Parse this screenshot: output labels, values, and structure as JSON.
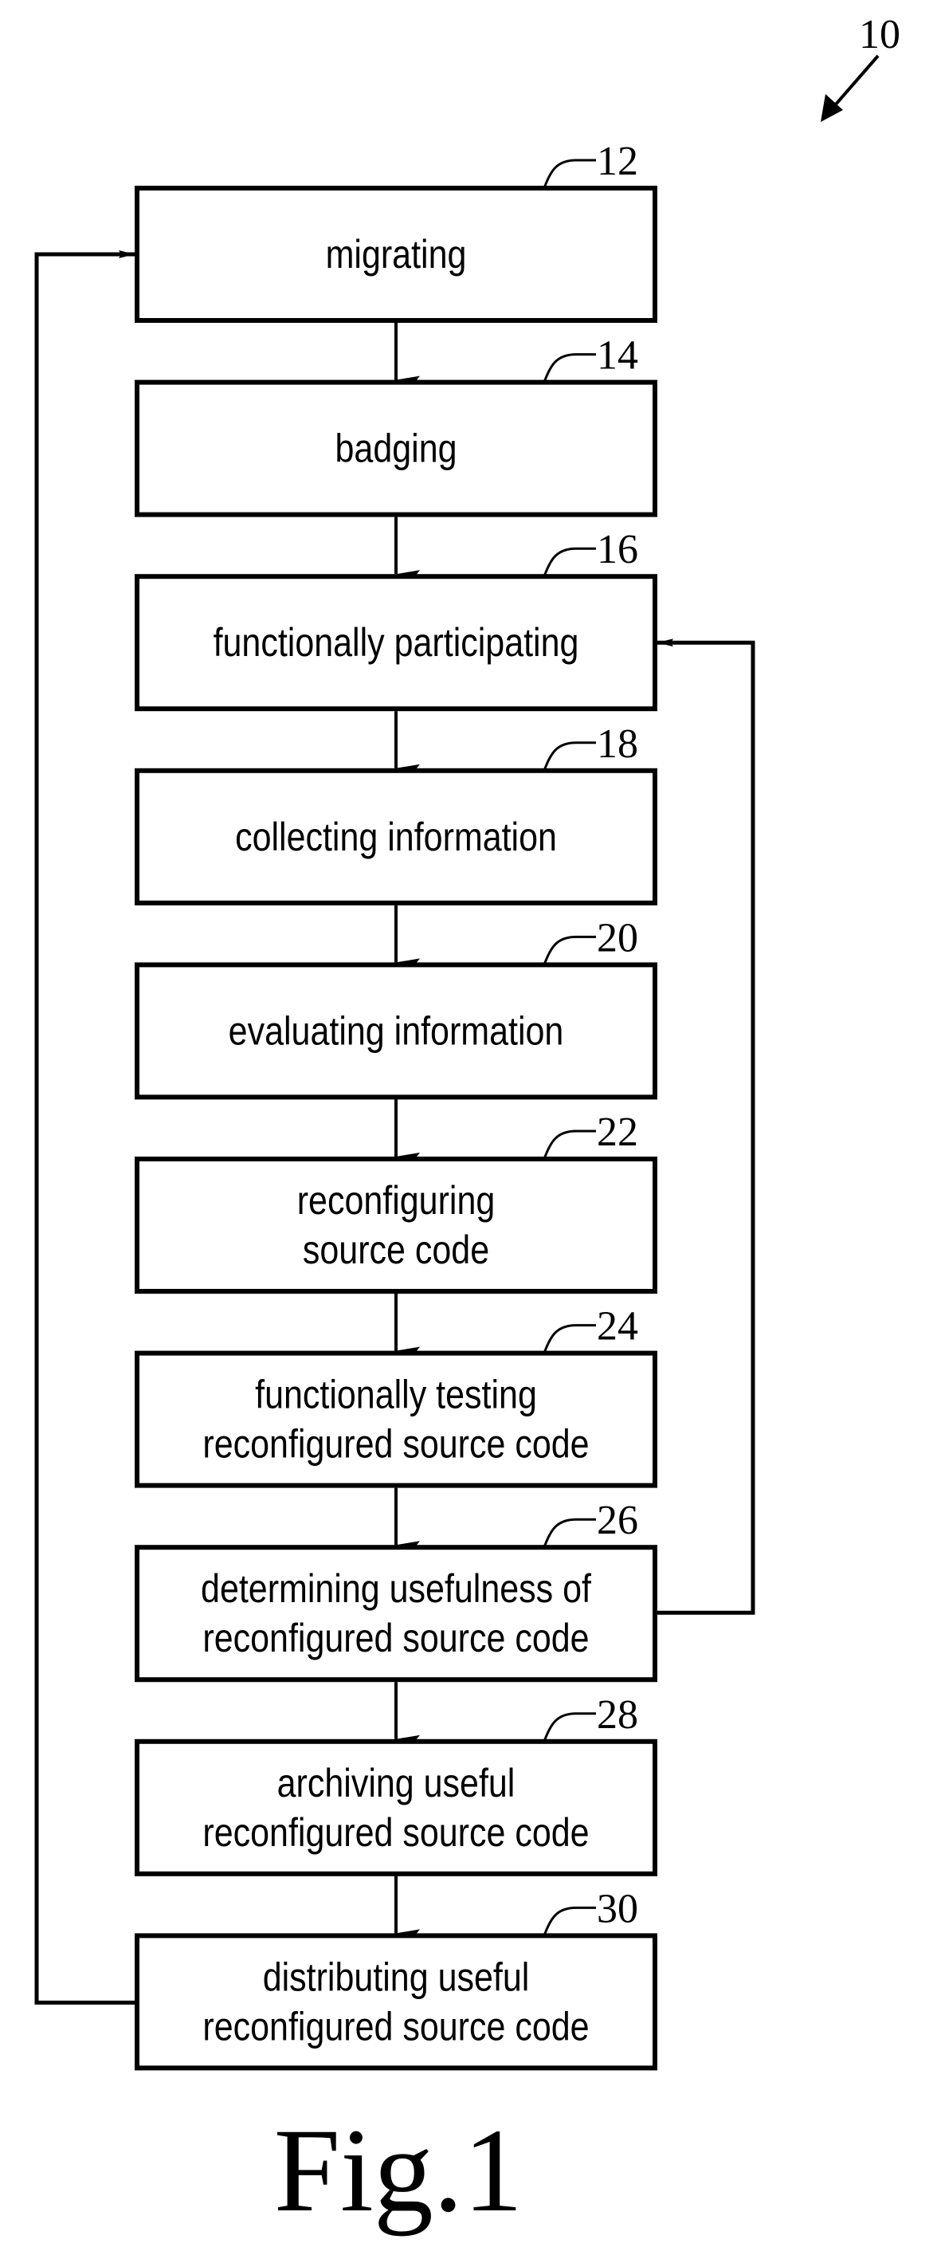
{
  "figure": {
    "reference": "10",
    "caption": "Fig.1"
  },
  "steps": [
    {
      "ref": "12",
      "lines": [
        "migrating"
      ]
    },
    {
      "ref": "14",
      "lines": [
        "badging"
      ]
    },
    {
      "ref": "16",
      "lines": [
        "functionally participating"
      ]
    },
    {
      "ref": "18",
      "lines": [
        "collecting information"
      ]
    },
    {
      "ref": "20",
      "lines": [
        "evaluating information"
      ]
    },
    {
      "ref": "22",
      "lines": [
        "reconfiguring",
        "source code"
      ]
    },
    {
      "ref": "24",
      "lines": [
        "functionally testing",
        "reconfigured source code"
      ]
    },
    {
      "ref": "26",
      "lines": [
        "determining usefulness of",
        "reconfigured source code"
      ]
    },
    {
      "ref": "28",
      "lines": [
        "archiving useful",
        "reconfigured source code"
      ]
    },
    {
      "ref": "30",
      "lines": [
        "distributing useful",
        "reconfigured source code"
      ]
    }
  ],
  "feedback_loops": [
    {
      "from": "30",
      "to": "12",
      "side": "left"
    },
    {
      "from": "26",
      "to": "16",
      "side": "right"
    }
  ]
}
